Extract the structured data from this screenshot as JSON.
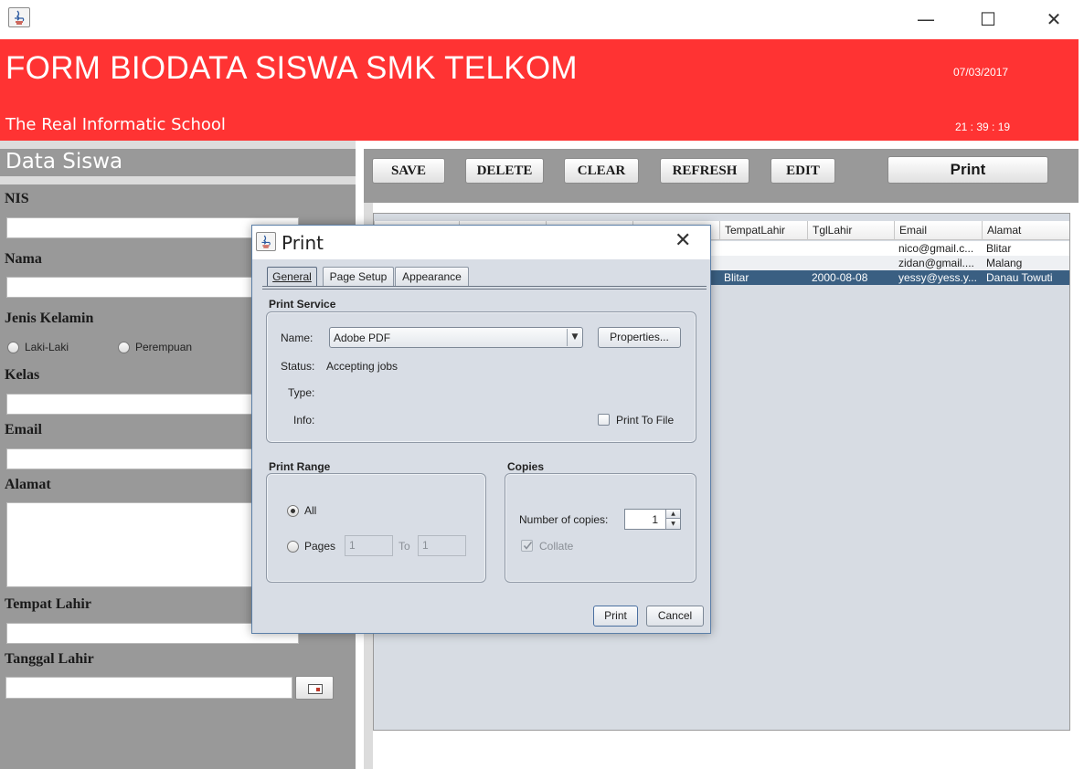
{
  "window": {
    "minimize_glyph": "—",
    "maximize_glyph": "☐",
    "close_glyph": "✕"
  },
  "header": {
    "title": "FORM BIODATA SISWA SMK TELKOM",
    "subtitle": "The Real Informatic School",
    "date": "07/03/2017",
    "time": "21 : 39 : 19",
    "color": "#ff3333"
  },
  "form": {
    "heading": "Data Siswa",
    "labels": {
      "nis": "NIS",
      "nama": "Nama",
      "jenis_kelamin": "Jenis Kelamin",
      "kelas": "Kelas",
      "email": "Email",
      "alamat": "Alamat",
      "tempat_lahir": "Tempat Lahir",
      "tanggal_lahir": "Tanggal Lahir"
    },
    "gender_options": [
      "Laki-Laki",
      "Perempuan"
    ]
  },
  "toolbar": {
    "save": "SAVE",
    "delete": "DELETE",
    "clear": "CLEAR",
    "refresh": "REFRESH",
    "edit": "EDIT",
    "print": "Print"
  },
  "table": {
    "columns": [
      "TempatLahir",
      "TglLahir",
      "Email",
      "Alamat"
    ],
    "rows": [
      {
        "tempat_lahir": "",
        "tgl_lahir": "",
        "email": "nico@gmail.c...",
        "alamat": "Blitar"
      },
      {
        "tempat_lahir": "",
        "tgl_lahir": "",
        "email": "zidan@gmail....",
        "alamat": "Malang"
      },
      {
        "tempat_lahir": "Blitar",
        "tgl_lahir": "2000-08-08",
        "email": "yessy@yess.y...",
        "alamat": "Danau Towuti",
        "selected": true
      }
    ],
    "selected_color": "#3a5f82"
  },
  "print_dialog": {
    "title": "Print",
    "tabs": [
      "General",
      "Page Setup",
      "Appearance"
    ],
    "active_tab": "General",
    "print_service": {
      "heading": "Print Service",
      "name_label": "Name:",
      "name_value": "Adobe PDF",
      "properties_button": "Properties...",
      "status_label": "Status:",
      "status_value": "Accepting jobs",
      "type_label": "Type:",
      "info_label": "Info:",
      "print_to_file": "Print To File"
    },
    "print_range": {
      "heading": "Print Range",
      "all": "All",
      "pages": "Pages",
      "from": "1",
      "to_label": "To",
      "to": "1"
    },
    "copies": {
      "heading": "Copies",
      "number_label": "Number of copies:",
      "number_value": "1",
      "collate": "Collate"
    },
    "print_button": "Print",
    "cancel_button": "Cancel"
  }
}
